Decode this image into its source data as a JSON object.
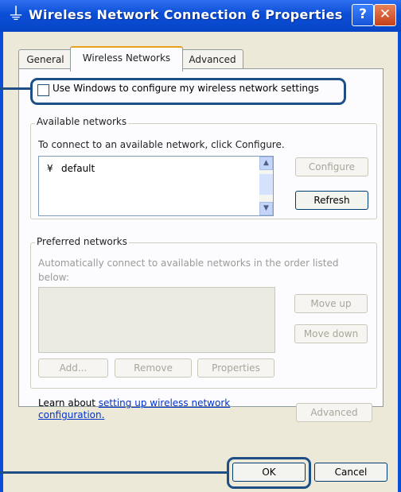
{
  "window": {
    "title": "Wireless Network Connection 6 Properties",
    "help_label": "?",
    "close_label": "✕"
  },
  "tabs": [
    {
      "label": "General"
    },
    {
      "label": "Wireless Networks"
    },
    {
      "label": "Advanced"
    }
  ],
  "wireless": {
    "use_windows_label": "Use Windows to configure my wireless network settings",
    "available": {
      "legend": "Available networks",
      "description": "To connect to an available network, click Configure.",
      "networks": [
        {
          "name": "default"
        }
      ],
      "configure_label": "Configure",
      "refresh_label": "Refresh"
    },
    "preferred": {
      "legend": "Preferred networks",
      "description": "Automatically connect to available networks in the order listed below:",
      "move_up_label": "Move up",
      "move_down_label": "Move down",
      "add_label": "Add...",
      "remove_label": "Remove",
      "properties_label": "Properties"
    },
    "learn_prefix": "Learn about ",
    "learn_link": "setting up wireless network configuration.",
    "advanced_label": "Advanced"
  },
  "footer": {
    "ok_label": "OK",
    "cancel_label": "Cancel"
  }
}
